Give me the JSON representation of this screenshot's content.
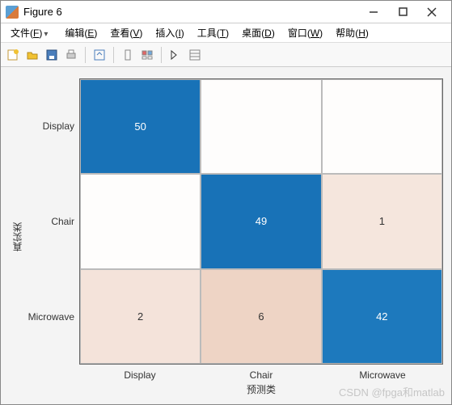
{
  "window": {
    "title": "Figure 6"
  },
  "menubar": {
    "items": [
      {
        "label": "文件",
        "mnemonic": "F",
        "has_dropdown": true
      },
      {
        "label": "编辑",
        "mnemonic": "E"
      },
      {
        "label": "查看",
        "mnemonic": "V"
      },
      {
        "label": "插入",
        "mnemonic": "I"
      },
      {
        "label": "工具",
        "mnemonic": "T"
      },
      {
        "label": "桌面",
        "mnemonic": "D"
      },
      {
        "label": "窗口",
        "mnemonic": "W"
      },
      {
        "label": "帮助",
        "mnemonic": "H"
      }
    ]
  },
  "toolbar": {
    "icons": [
      "new-figure-icon",
      "open-icon",
      "save-icon",
      "print-icon",
      "sep",
      "link-source-icon",
      "sep",
      "data-cursor-icon",
      "legend-icon",
      "sep",
      "edit-plot-icon",
      "property-inspector-icon"
    ]
  },
  "chart_data": {
    "type": "heatmap",
    "title": "",
    "xlabel": "预测类",
    "ylabel": "真实类",
    "x_categories": [
      "Display",
      "Chair",
      "Microwave"
    ],
    "y_categories": [
      "Display",
      "Chair",
      "Microwave"
    ],
    "values": [
      [
        50,
        null,
        null
      ],
      [
        null,
        49,
        1
      ],
      [
        2,
        6,
        42
      ]
    ],
    "cell_colors": [
      [
        "#1872b7",
        "#fefdfc",
        "#fefdfc"
      ],
      [
        "#fefdfc",
        "#1872b7",
        "#f5e6dd"
      ],
      [
        "#f4e3da",
        "#eed4c5",
        "#1d79bd"
      ]
    ],
    "cell_text_colors": [
      [
        "#ffffff",
        "#333333",
        "#333333"
      ],
      [
        "#333333",
        "#ffffff",
        "#333333"
      ],
      [
        "#333333",
        "#333333",
        "#ffffff"
      ]
    ]
  },
  "watermark": "CSDN @fpga和matlab"
}
